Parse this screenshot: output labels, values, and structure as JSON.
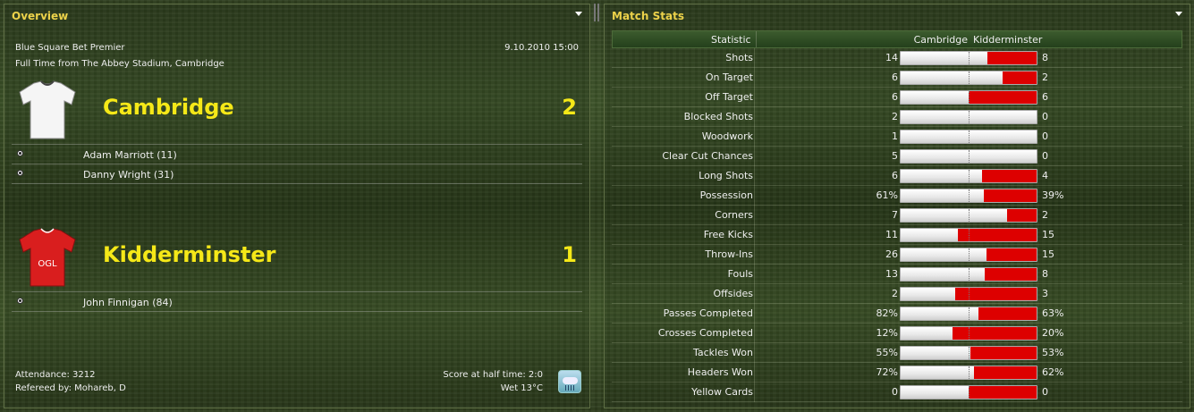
{
  "overview": {
    "title": "Overview",
    "competition": "Blue Square Bet Premier",
    "datetime": "9.10.2010 15:00",
    "venue": "Full Time from The Abbey Stadium, Cambridge",
    "home": {
      "name": "Cambridge",
      "score": "2",
      "kit_color": "#ffffff",
      "scorers": [
        "Adam Marriott (11)",
        "Danny Wright (31)"
      ]
    },
    "away": {
      "name": "Kidderminster",
      "score": "1",
      "kit_color": "#dd2020",
      "kit_text": "OGL",
      "scorers": [
        "John Finnigan (84)"
      ]
    },
    "attendance": "Attendance: 3212",
    "referee": "Refereed by: Mohareb, D",
    "halftime": "Score at half time: 2:0",
    "weather": "Wet 13°C",
    "weather_icon": "rain-cloud-icon"
  },
  "stats": {
    "title": "Match Stats",
    "header": {
      "statistic": "Statistic",
      "home": "Cambridge",
      "away": "Kidderminster"
    },
    "colors": {
      "home_bar": "#e8e8e8",
      "away_bar": "#dd0000"
    },
    "rows": [
      {
        "label": "Shots",
        "home": "14",
        "away": "8",
        "home_share": 0.64
      },
      {
        "label": "On Target",
        "home": "6",
        "away": "2",
        "home_share": 0.75
      },
      {
        "label": "Off Target",
        "home": "6",
        "away": "6",
        "home_share": 0.5
      },
      {
        "label": "Blocked Shots",
        "home": "2",
        "away": "0",
        "home_share": 1.0
      },
      {
        "label": "Woodwork",
        "home": "1",
        "away": "0",
        "home_share": 1.0
      },
      {
        "label": "Clear Cut Chances",
        "home": "5",
        "away": "0",
        "home_share": 1.0
      },
      {
        "label": "Long Shots",
        "home": "6",
        "away": "4",
        "home_share": 0.6
      },
      {
        "label": "Possession",
        "home": "61%",
        "away": "39%",
        "home_share": 0.61
      },
      {
        "label": "Corners",
        "home": "7",
        "away": "2",
        "home_share": 0.78
      },
      {
        "label": "Free Kicks",
        "home": "11",
        "away": "15",
        "home_share": 0.42
      },
      {
        "label": "Throw-Ins",
        "home": "26",
        "away": "15",
        "home_share": 0.63
      },
      {
        "label": "Fouls",
        "home": "13",
        "away": "8",
        "home_share": 0.62
      },
      {
        "label": "Offsides",
        "home": "2",
        "away": "3",
        "home_share": 0.4
      },
      {
        "label": "Passes Completed",
        "home": "82%",
        "away": "63%",
        "home_share": 0.57
      },
      {
        "label": "Crosses Completed",
        "home": "12%",
        "away": "20%",
        "home_share": 0.38
      },
      {
        "label": "Tackles Won",
        "home": "55%",
        "away": "53%",
        "home_share": 0.51
      },
      {
        "label": "Headers Won",
        "home": "72%",
        "away": "62%",
        "home_share": 0.54
      },
      {
        "label": "Yellow Cards",
        "home": "0",
        "away": "0",
        "home_share": 0.5
      }
    ]
  }
}
